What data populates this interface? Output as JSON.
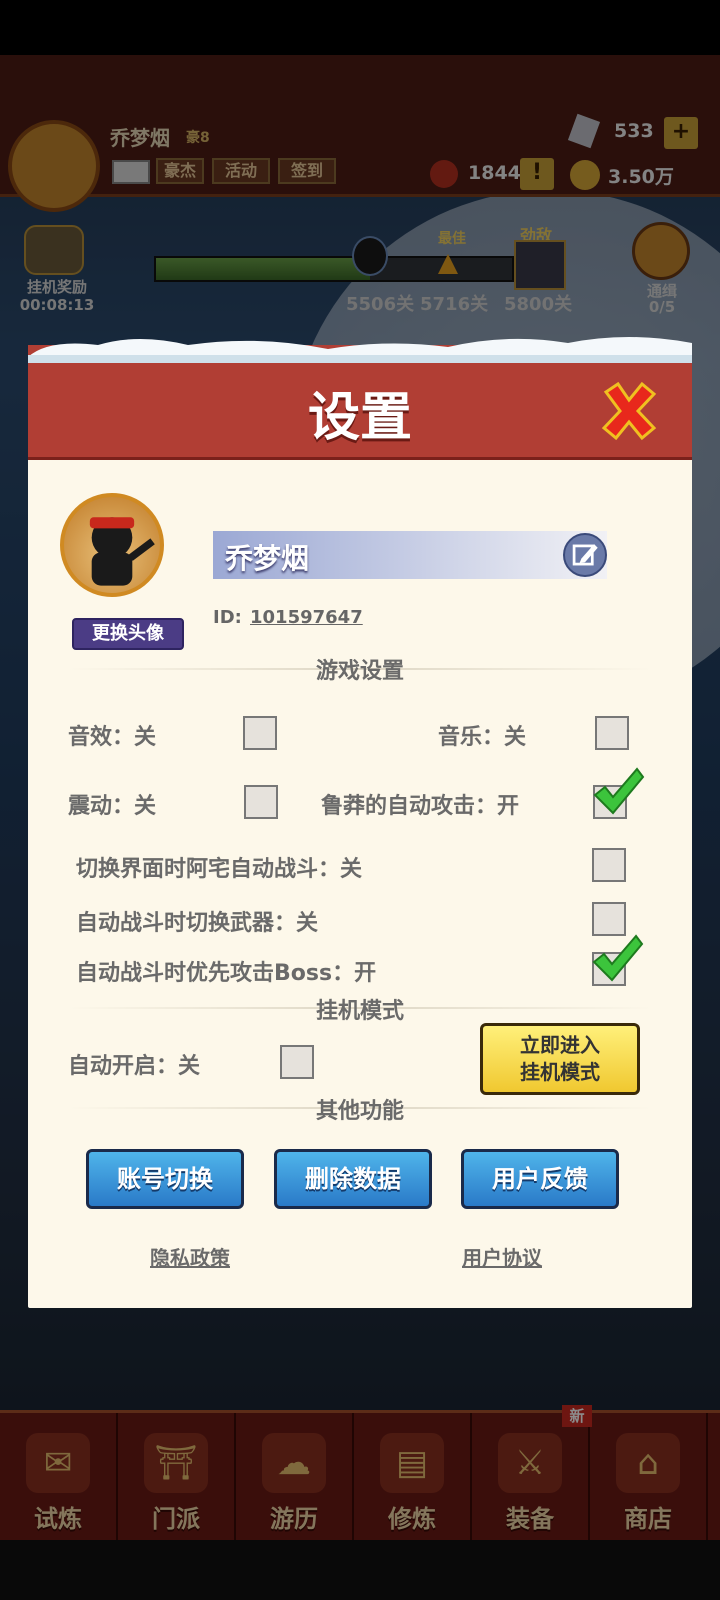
{
  "header": {
    "player_name": "乔梦烟",
    "vip": "豪8",
    "chips": [
      "豪杰",
      "活动",
      "签到"
    ],
    "gems": "533",
    "tickets": "1844",
    "gold": "3.50万",
    "plus": "+",
    "alert": "!"
  },
  "side": {
    "afk_reward_label": "挂机奖励",
    "afk_timer": "00:08:13",
    "bounty_label": "通缉",
    "bounty_count": "0/5"
  },
  "progress": {
    "best_label": "最佳",
    "enemy_label": "劲敌",
    "current": "5506关",
    "best": "5716关",
    "rival": "5800关",
    "current_fraction": 0.6,
    "best_fraction": 0.82
  },
  "dialog": {
    "title": "设置",
    "change_avatar": "更换头像",
    "name": "乔梦烟",
    "id_label": "ID:",
    "id_value": "101597647",
    "sections": {
      "game": "游戏设置",
      "afk": "挂机模式",
      "other": "其他功能"
    },
    "options": {
      "sound": "音效：关",
      "music": "音乐：关",
      "vibration": "震动：关",
      "auto_attack": "鲁莽的自动攻击：开",
      "switch_autofight": "切换界面时阿宅自动战斗：关",
      "switch_weapon": "自动战斗时切换武器：关",
      "boss_first": "自动战斗时优先攻击Boss：开",
      "afk_auto": "自动开启：关"
    },
    "checked": {
      "sound": false,
      "music": false,
      "vibration": false,
      "auto_attack": true,
      "switch_autofight": false,
      "switch_weapon": false,
      "boss_first": true,
      "afk_auto": false
    },
    "enter_afk_line1": "立即进入",
    "enter_afk_line2": "挂机模式",
    "buttons": {
      "switch_account": "账号切换",
      "delete_data": "删除数据",
      "feedback": "用户反馈"
    },
    "privacy": "隐私政策",
    "agreement": "用户协议"
  },
  "bottom_nav": [
    {
      "label": "试炼",
      "icon": "scroll-icon"
    },
    {
      "label": "门派",
      "icon": "sect-icon"
    },
    {
      "label": "游历",
      "icon": "travel-icon"
    },
    {
      "label": "修炼",
      "icon": "book-icon"
    },
    {
      "label": "装备",
      "icon": "sword-icon"
    },
    {
      "label": "商店",
      "icon": "shop-icon"
    }
  ],
  "new_badge": "新",
  "colors": {
    "dialog_header": "#b13e34",
    "dialog_body": "#fdf8ea",
    "check_green": "#3cc43c",
    "close_red": "#e8281c",
    "button_blue": "#3a96dc",
    "button_yellow": "#f6d848"
  }
}
